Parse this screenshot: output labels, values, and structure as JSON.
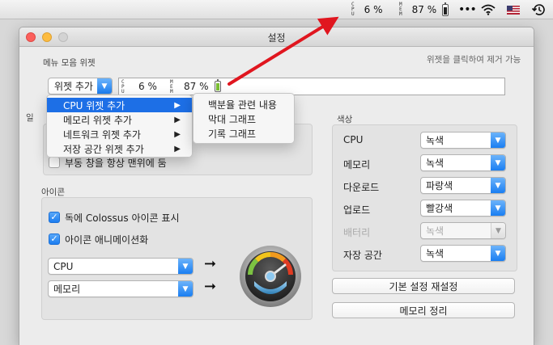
{
  "menubar": {
    "cpu_label": [
      "C",
      "P",
      "U"
    ],
    "cpu_value": "6 %",
    "mem_label": [
      "M",
      "E",
      "M"
    ],
    "mem_value": "87 %",
    "icons": [
      "battery-icon",
      "more-dots-icon",
      "wifi-icon",
      "us-flag-icon",
      "time-machine-icon"
    ],
    "dots": "•••"
  },
  "window": {
    "title": "설정",
    "menubar_widgets": {
      "section_label": "메뉴 모음 위젯",
      "hint": "위젯을 클릭하여 제거 가능",
      "add_widget_button": "위젯 추가",
      "preview": {
        "cpu_label": [
          "C",
          "P",
          "U"
        ],
        "cpu_value": "6 %",
        "mem_label": [
          "M",
          "E",
          "M"
        ],
        "mem_value": "87 %"
      }
    },
    "general": {
      "section_label_partial": "일",
      "floating_window_label": "부동 창을 항상 맨위에 둠"
    },
    "icon": {
      "section_label": "아이콘",
      "show_dock_icon": "독에 Colossus 아이콘 표시",
      "animate_icon": "아이콘 애니메이션화",
      "source1": "CPU",
      "source2": "메모리",
      "arrow": "➞"
    },
    "color": {
      "section_label": "색상",
      "rows": [
        {
          "label": "CPU",
          "value": "녹색",
          "enabled": true
        },
        {
          "label": "메모리",
          "value": "녹색",
          "enabled": true
        },
        {
          "label": "다운로드",
          "value": "파랑색",
          "enabled": true
        },
        {
          "label": "업로드",
          "value": "빨강색",
          "enabled": true
        },
        {
          "label": "배터리",
          "value": "녹색",
          "enabled": false
        },
        {
          "label": "자장 공간",
          "value": "녹색",
          "enabled": true
        }
      ]
    },
    "reset_button": "기본 설정 재설정",
    "purge_memory_button": "메모리 정리"
  },
  "add_widget_menu": {
    "items": [
      {
        "label": "CPU 위젯 추가",
        "selected": true
      },
      {
        "label": "메모리 위젯 추가",
        "selected": false
      },
      {
        "label": "네트워크 위젯 추가",
        "selected": false
      },
      {
        "label": "저장 공간 위젯 추가",
        "selected": false
      }
    ],
    "submenu_glyph": "▶",
    "submenu": [
      "백분율 관련 내용",
      "막대 그래프",
      "기록 그래프"
    ]
  },
  "colors": {
    "accent": "#1d6fe6",
    "annotation_arrow": "#e0161f"
  }
}
